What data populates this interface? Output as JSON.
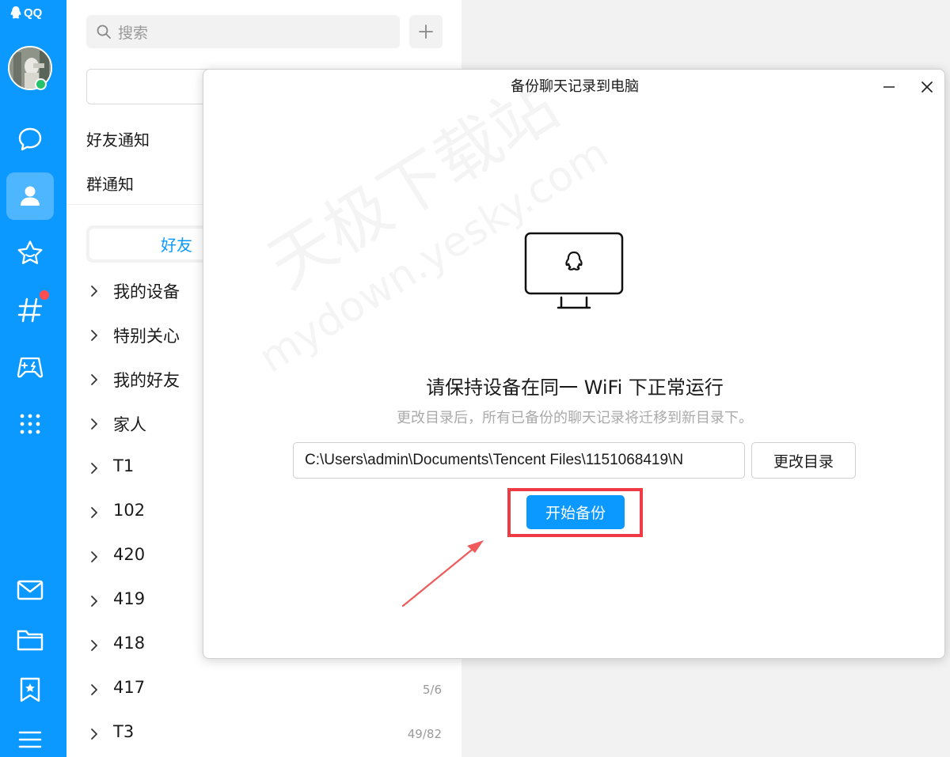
{
  "app": {
    "logo_text": "QQ"
  },
  "rail": {
    "items": [
      {
        "icon": "chat-bubble-icon"
      },
      {
        "icon": "contacts-icon",
        "active": true
      },
      {
        "icon": "star-icon"
      },
      {
        "icon": "hashtag-icon",
        "badge": true
      },
      {
        "icon": "game-icon"
      },
      {
        "icon": "apps-grid-icon"
      },
      {
        "icon": "mail-icon"
      },
      {
        "icon": "folder-icon"
      },
      {
        "icon": "bookmark-star-icon"
      },
      {
        "icon": "menu-icon"
      }
    ]
  },
  "contacts": {
    "search_placeholder": "搜索",
    "friend_notice": "好友通知",
    "group_notice": "群通知",
    "active_tab": "好友",
    "groups": [
      {
        "name": "我的设备",
        "count": ""
      },
      {
        "name": "特别关心",
        "count": ""
      },
      {
        "name": "我的好友",
        "count": ""
      },
      {
        "name": "家人",
        "count": ""
      },
      {
        "name": "T1",
        "count": ""
      },
      {
        "name": "102",
        "count": ""
      },
      {
        "name": "420",
        "count": ""
      },
      {
        "name": "419",
        "count": ""
      },
      {
        "name": "418",
        "count": ""
      },
      {
        "name": "417",
        "count": "5/6"
      },
      {
        "name": "T3",
        "count": "49/82"
      }
    ]
  },
  "dialog": {
    "title": "备份聊天记录到电脑",
    "heading": "请保持设备在同一 WiFi 下正常运行",
    "subtext": "更改目录后，所有已备份的聊天记录将迁移到新目录下。",
    "path_value": "C:\\Users\\admin\\Documents\\Tencent Files\\1151068419\\N",
    "change_dir_label": "更改目录",
    "start_backup_label": "开始备份"
  },
  "watermark": {
    "line1": "天极下载站",
    "line2": "mydown.yesky.com"
  },
  "colors": {
    "brand": "#0b99ff",
    "highlight": "#ef3b46"
  }
}
